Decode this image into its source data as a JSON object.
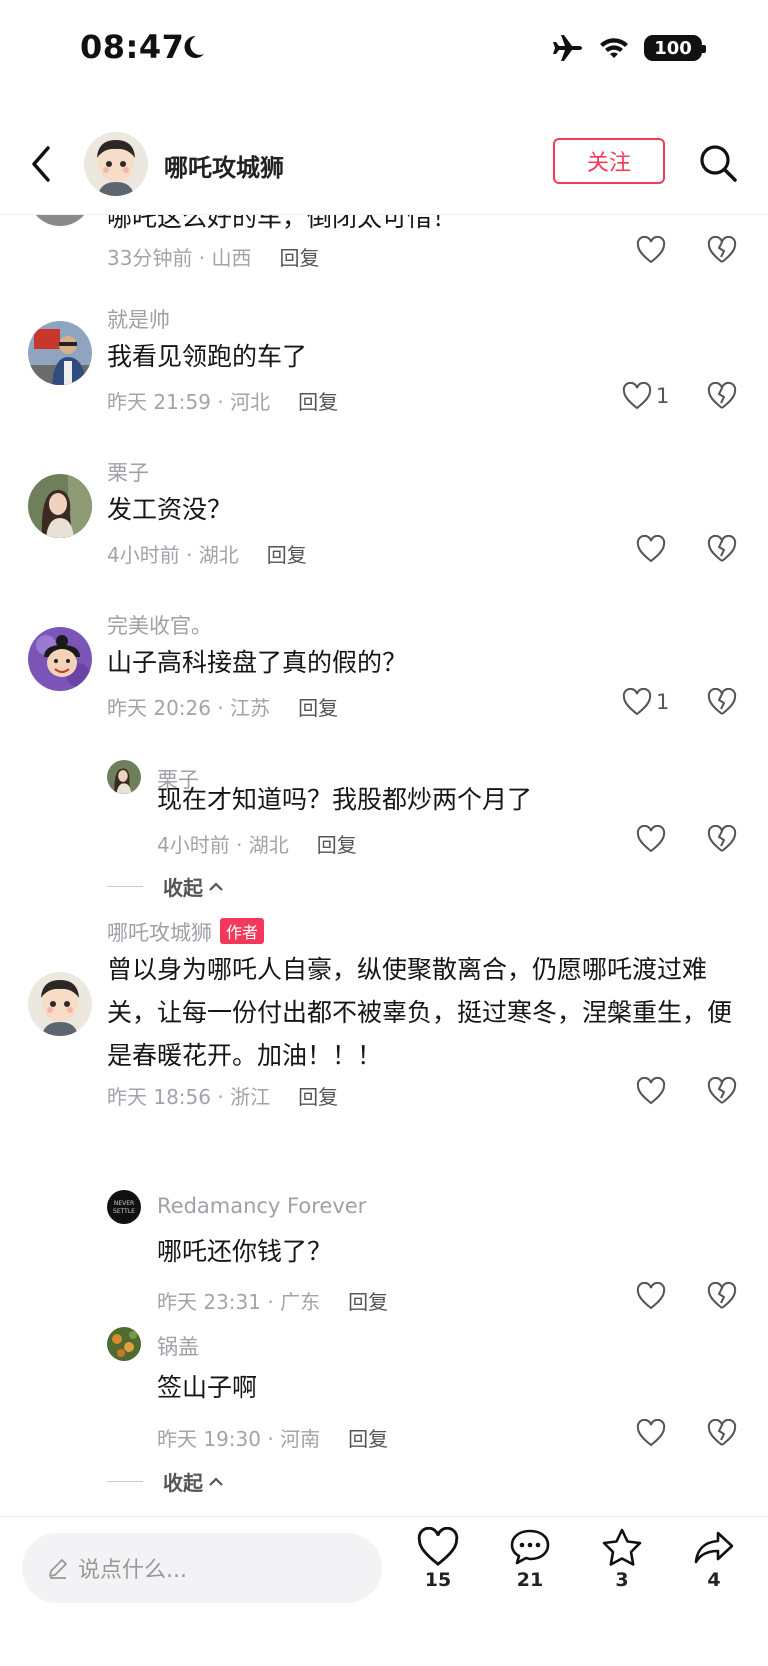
{
  "status": {
    "time": "08:47",
    "battery": "100"
  },
  "header": {
    "name": "哪吒攻城狮",
    "follow_label": "关注"
  },
  "comments": [
    {
      "text": "哪吒这么好的车，倒闭太可惜！",
      "meta": "33分钟前 · 山西",
      "reply": "回复",
      "likes": ""
    },
    {
      "user": "就是帅",
      "text": "我看见领跑的车了",
      "meta": "昨天 21:59 · 河北",
      "reply": "回复",
      "likes": "1"
    },
    {
      "user": "栗子",
      "text": "发工资没？",
      "meta": "4小时前 · 湖北",
      "reply": "回复",
      "likes": ""
    },
    {
      "user": "完美收官。",
      "text": "山子高科接盘了真的假的？",
      "meta": "昨天 20:26 · 江苏",
      "reply": "回复",
      "likes": "1"
    },
    {
      "user": "栗子",
      "text": "现在才知道吗？我股都炒两个月了",
      "meta": "4小时前 · 湖北",
      "reply": "回复",
      "likes": ""
    },
    {
      "user": "哪吒攻城狮",
      "badge": "作者",
      "text": "曾以身为哪吒人自豪，纵使聚散离合，仍愿哪吒渡过难关，让每一份付出都不被辜负，挺过寒冬，涅槃重生，便是春暖花开。加油！！！",
      "meta": "昨天 18:56 · 浙江",
      "reply": "回复",
      "likes": ""
    },
    {
      "user": "Redamancy Forever",
      "text": "哪吒还你钱了？",
      "meta": "昨天 23:31 · 广东",
      "reply": "回复",
      "likes": ""
    },
    {
      "user": "锅盖",
      "text": "签山子啊",
      "meta": "昨天 19:30 · 河南",
      "reply": "回复",
      "likes": ""
    }
  ],
  "collapse_label": "收起",
  "bottom": {
    "placeholder": "说点什么...",
    "like_count": "15",
    "comment_count": "21",
    "star_count": "3",
    "share_count": "4"
  },
  "colors": {
    "accent": "#f23c5a",
    "meta": "#a3a3ab",
    "text": "#161616"
  },
  "icons": [
    "moon-icon",
    "airplane-icon",
    "wifi-icon",
    "back-icon",
    "search-icon",
    "heart-icon",
    "broken-heart-icon",
    "pencil-icon",
    "comment-icon",
    "star-icon",
    "share-icon"
  ]
}
